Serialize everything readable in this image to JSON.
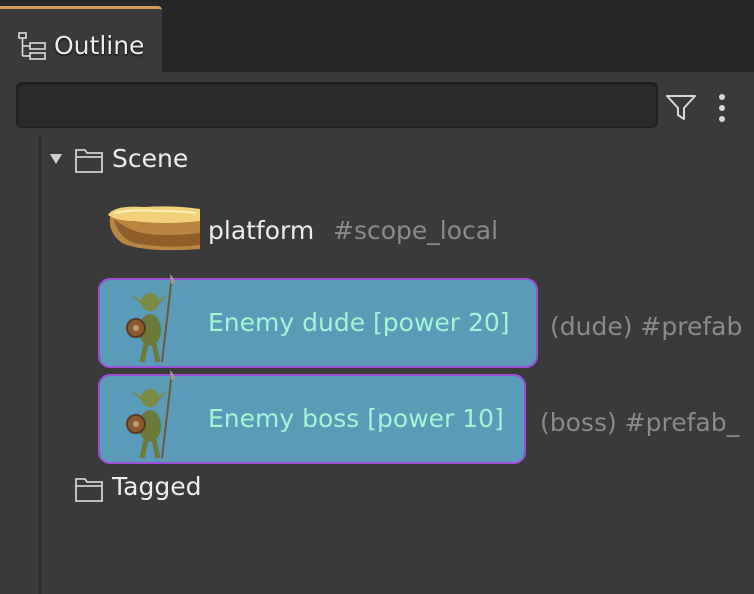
{
  "tab": {
    "label": "Outline",
    "icon": "outline-tree-icon"
  },
  "search": {
    "value": "",
    "placeholder": ""
  },
  "toolbar": {
    "filter_icon": "filter-icon",
    "menu_icon": "more-vertical-icon"
  },
  "tree": {
    "scene": {
      "label": "Scene",
      "expanded": true,
      "icon": "folder-icon"
    },
    "items": [
      {
        "label": "platform",
        "suffix": "#scope_local",
        "icon": "platform-thumbnail",
        "selected": false
      },
      {
        "label": "Enemy dude [power 20]",
        "suffix": "(dude) #prefab",
        "icon": "goblin-thumbnail",
        "selected": true
      },
      {
        "label": "Enemy boss [power 10]",
        "suffix": "(boss) #prefab_",
        "icon": "goblin-thumbnail",
        "selected": true
      }
    ],
    "tagged": {
      "label": "Tagged",
      "icon": "folder-icon"
    }
  },
  "colors": {
    "tab_accent": "#d39b52",
    "selection_bg": "#5a9cb8",
    "selection_border": "#9b4fd6",
    "selected_text": "#a6f2d9"
  }
}
